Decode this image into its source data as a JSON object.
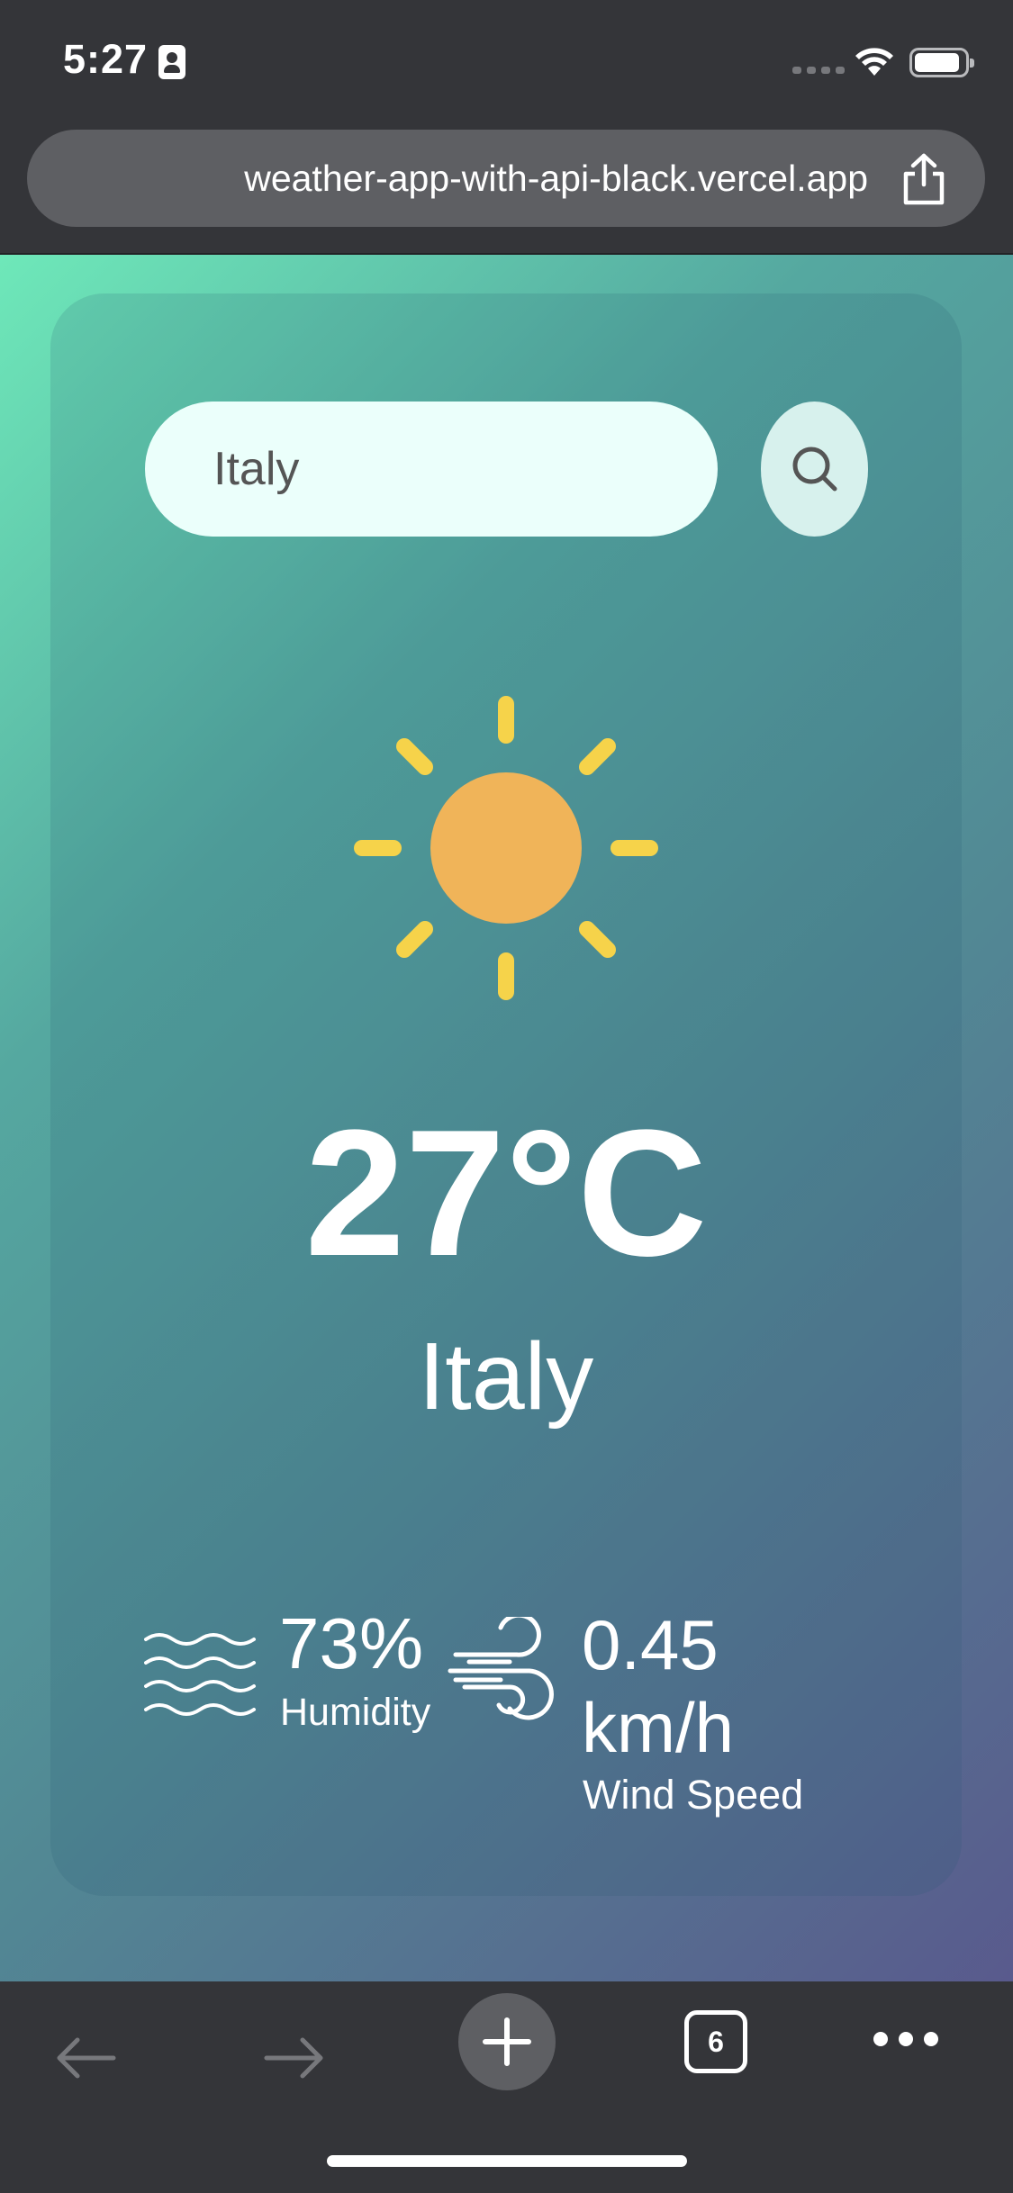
{
  "status_bar": {
    "time": "5:27"
  },
  "browser": {
    "url": "weather-app-with-api-black.vercel.app",
    "tab_count": "6"
  },
  "weather": {
    "search_value": "Italy",
    "condition_icon": "sun-icon",
    "temperature": "27°C",
    "city": "Italy",
    "humidity_value": "73%",
    "humidity_label": "Humidity",
    "wind_value": "0.45 km/h",
    "wind_label": "Wind Speed"
  },
  "colors": {
    "gradient_start": "#6ee8b9",
    "gradient_end": "#595a8d",
    "search_bg": "#ebfffb",
    "sun_core": "#f0b459",
    "sun_rays": "#f6d34a",
    "toolbar_bg": "#343539"
  }
}
